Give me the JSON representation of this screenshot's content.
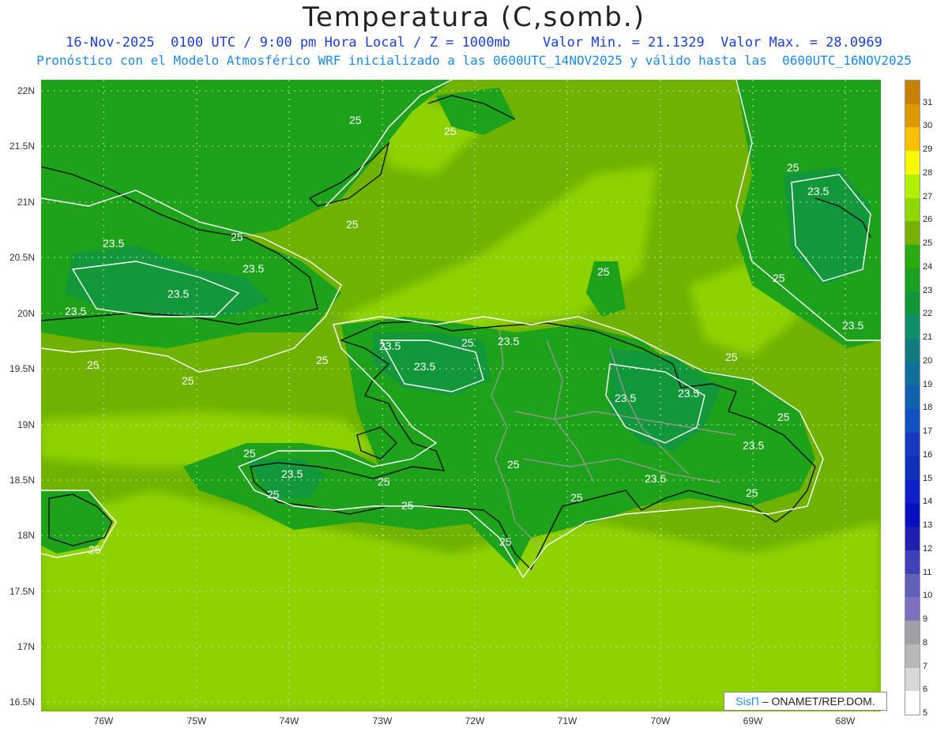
{
  "title": "Temperatura (C,somb.)",
  "subtitle1": "16-Nov-2025  0100 UTC / 9:00 pm Hora Local / Z = 1000mb    Valor Min. = 21.1329  Valor Max. = 28.0969",
  "subtitle2": "Pronóstico con el Modelo Atmosférico WRF inicializado a las 0600UTC_14NOV2025 y válido hasta las  0600UTC_16NOV2025",
  "lat_labels": [
    "22N",
    "21.5N",
    "21N",
    "20.5N",
    "20N",
    "19.5N",
    "19N",
    "18.5N",
    "18N",
    "17.5N",
    "17N",
    "16.5N"
  ],
  "lon_labels": [
    "76W",
    "75W",
    "74W",
    "73W",
    "72W",
    "71W",
    "70W",
    "69W",
    "68W"
  ],
  "contour_labels": [
    "25",
    "23.5"
  ],
  "colorbar": {
    "levels": [
      "31",
      "30",
      "29",
      "28",
      "27",
      "26",
      "25",
      "24",
      "23",
      "22",
      "21",
      "20",
      "19",
      "18",
      "17",
      "16",
      "15",
      "14",
      "13",
      "12",
      "11",
      "10",
      "9",
      "8",
      "7",
      "6",
      "5"
    ],
    "colors": [
      "#c88000",
      "#e09800",
      "#f8c000",
      "#f8f800",
      "#b0f000",
      "#90d800",
      "#78b000",
      "#2aaa10",
      "#18a020",
      "#109838",
      "#10906a",
      "#107c80",
      "#10709a",
      "#1060b0",
      "#1050c0",
      "#1838c0",
      "#1030b8",
      "#1020c8",
      "#0810c0",
      "#2020b0",
      "#4040b8",
      "#6060b8",
      "#8070c0",
      "#a0a0a8",
      "#b8b8b8",
      "#d8d8d8",
      "#ffffff"
    ]
  },
  "credit": {
    "brand": "SisΠ",
    "org": "– ONAMET/REP.DOM."
  }
}
